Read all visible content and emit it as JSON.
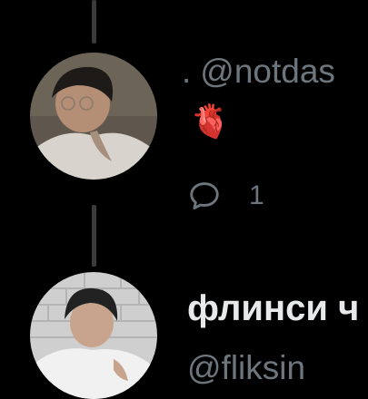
{
  "tweet1": {
    "prefix": ".",
    "handle": "@notdas",
    "emoji": "🫀",
    "reply_count": "1",
    "icons": {
      "reply": "reply-bubble-icon",
      "avatar": "avatar"
    }
  },
  "tweet2": {
    "display_name": "флинси ч",
    "handle": "@fliksin",
    "icons": {
      "avatar": "avatar"
    }
  },
  "colors": {
    "background": "#000000",
    "secondary_text": "#6e767d",
    "primary_text": "#e7e9ea",
    "thread_line": "#3b3b3e"
  }
}
